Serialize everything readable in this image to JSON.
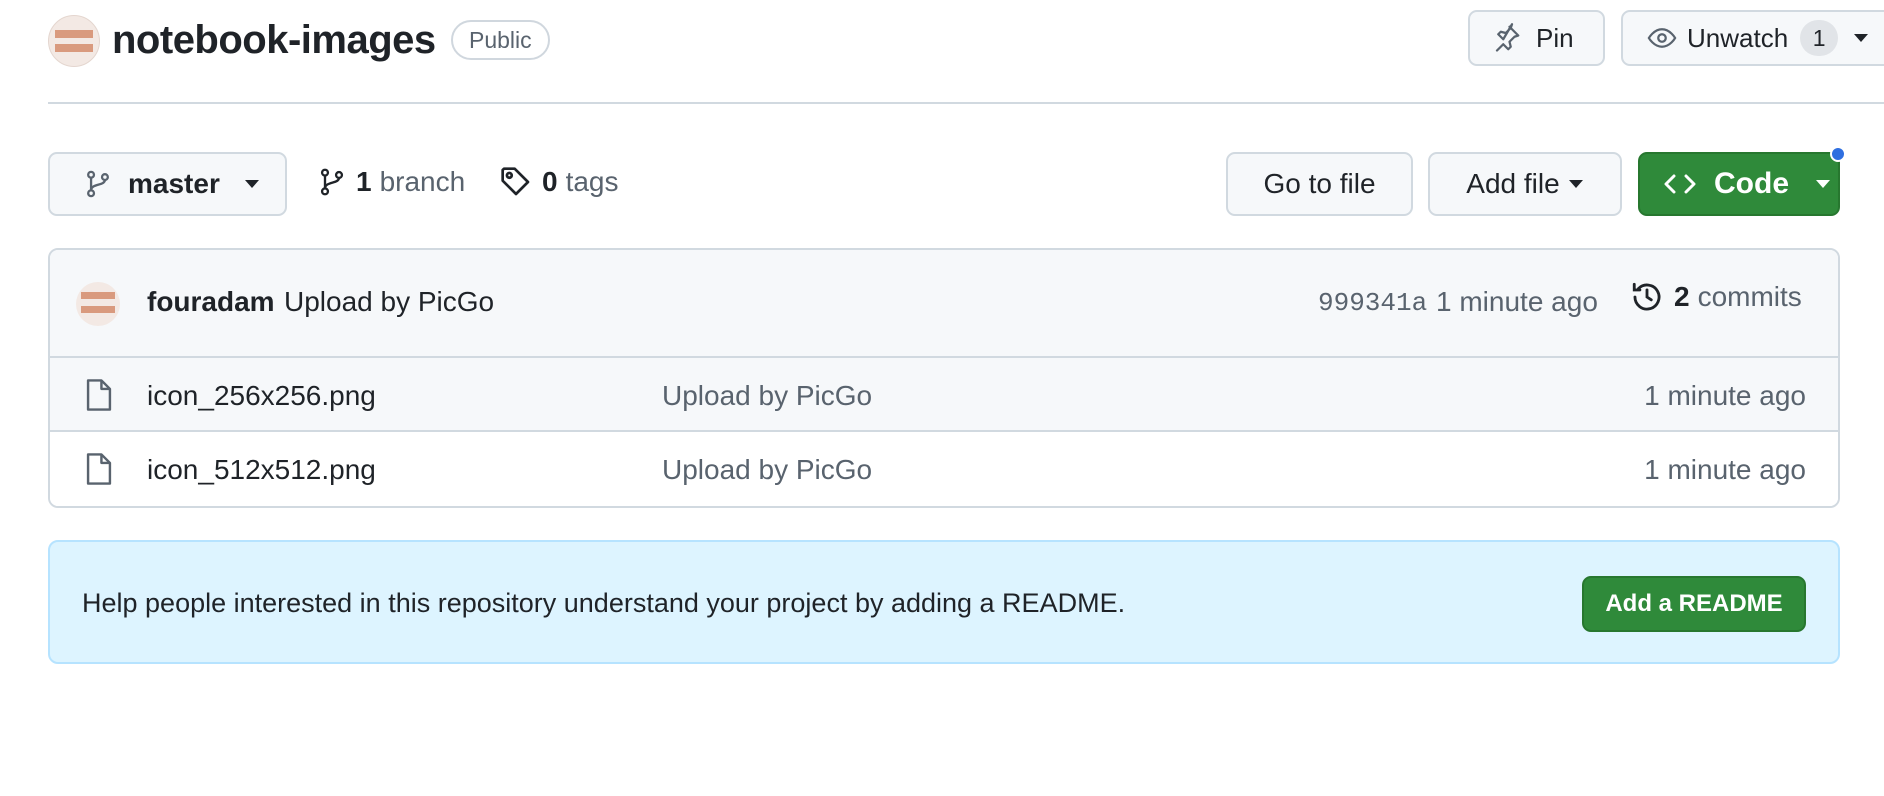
{
  "repo": {
    "name": "notebook-images",
    "visibility": "Public"
  },
  "actions": {
    "pin_label": "Pin",
    "watch_label": "Unwatch",
    "watch_count": "1"
  },
  "toolbar": {
    "branch_name": "master",
    "branch_count": "1",
    "branch_label": "branch",
    "tag_count": "0",
    "tag_label": "tags",
    "goto_file_label": "Go to file",
    "add_file_label": "Add file",
    "code_label": "Code"
  },
  "latest_commit": {
    "author": "fouradam",
    "message": "Upload by PicGo",
    "sha": "999341a",
    "time": "1 minute ago",
    "commit_count": "2",
    "commits_label": "commits"
  },
  "files": [
    {
      "name": "icon_256x256.png",
      "commit_message": "Upload by PicGo",
      "time": "1 minute ago"
    },
    {
      "name": "icon_512x512.png",
      "commit_message": "Upload by PicGo",
      "time": "1 minute ago"
    }
  ],
  "readme_banner": {
    "text": "Help people interested in this repository understand your project by adding a README.",
    "button_label": "Add a README"
  },
  "colors": {
    "primary_green": "#2f8a3a",
    "banner_bg": "#ddf4ff",
    "notification_dot": "#2f6fe0"
  },
  "icons": {
    "branch": "git-branch-icon",
    "tag": "tag-icon",
    "code": "code-icon",
    "history": "history-icon",
    "file": "file-icon",
    "pin": "pin-icon",
    "eye": "eye-icon"
  }
}
